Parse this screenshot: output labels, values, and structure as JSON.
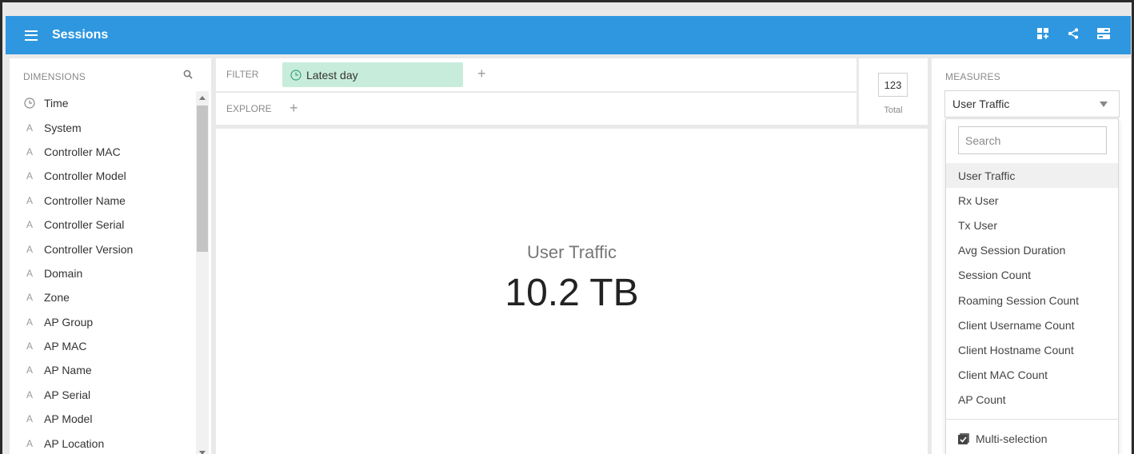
{
  "header": {
    "title": "Sessions",
    "icons": [
      "menu-icon",
      "add-widget-icon",
      "share-icon",
      "toggle-layout-icon"
    ],
    "background_color": "#2f97e0"
  },
  "dimensions": {
    "caption": "DIMENSIONS",
    "items": [
      {
        "label": "Time",
        "icon": "clock-icon"
      },
      {
        "label": "System",
        "icon": "string-type-icon"
      },
      {
        "label": "Controller MAC",
        "icon": "string-type-icon"
      },
      {
        "label": "Controller Model",
        "icon": "string-type-icon"
      },
      {
        "label": "Controller Name",
        "icon": "string-type-icon"
      },
      {
        "label": "Controller Serial",
        "icon": "string-type-icon"
      },
      {
        "label": "Controller Version",
        "icon": "string-type-icon"
      },
      {
        "label": "Domain",
        "icon": "string-type-icon"
      },
      {
        "label": "Zone",
        "icon": "string-type-icon"
      },
      {
        "label": "AP Group",
        "icon": "string-type-icon"
      },
      {
        "label": "AP MAC",
        "icon": "string-type-icon"
      },
      {
        "label": "AP Name",
        "icon": "string-type-icon"
      },
      {
        "label": "AP Serial",
        "icon": "string-type-icon"
      },
      {
        "label": "AP Model",
        "icon": "string-type-icon"
      },
      {
        "label": "AP Location",
        "icon": "string-type-icon"
      }
    ]
  },
  "filter": {
    "caption": "FILTER",
    "pill_label": "Latest day",
    "pill_color": "#c8ecdc"
  },
  "explore": {
    "caption": "EXPLORE"
  },
  "total": {
    "value": "123",
    "label": "Total"
  },
  "visualization": {
    "label": "User Traffic",
    "value": "10.2 TB"
  },
  "measures": {
    "caption": "MEASURES",
    "selected": "User Traffic",
    "search_placeholder": "Search",
    "options": [
      "User Traffic",
      "Rx User",
      "Tx User",
      "Avg Session Duration",
      "Session Count",
      "Roaming Session Count",
      "Client Username Count",
      "Client Hostname Count",
      "Client MAC Count",
      "AP Count"
    ],
    "multi_selection_label": "Multi-selection"
  }
}
